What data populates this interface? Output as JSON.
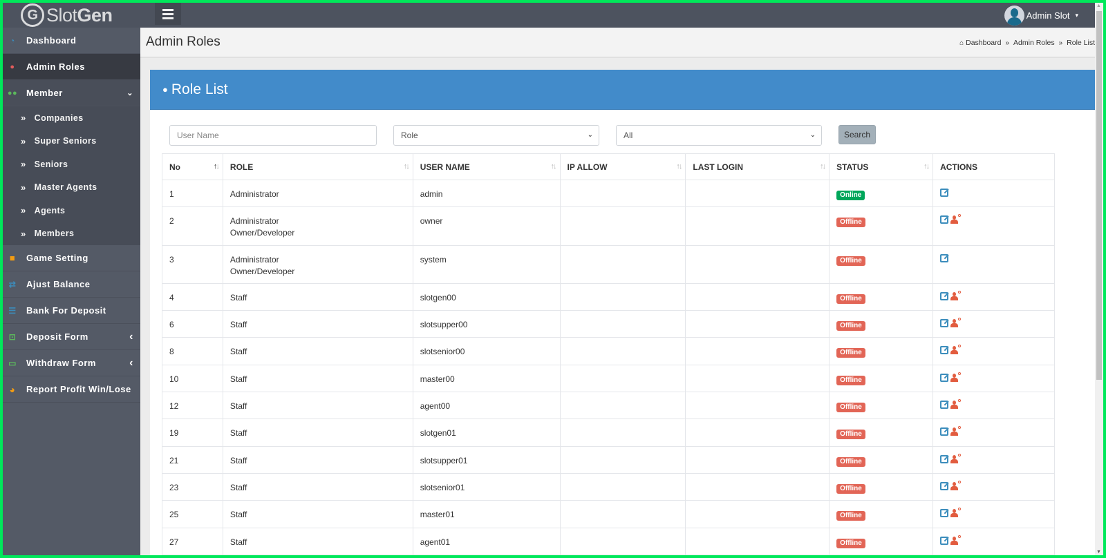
{
  "app": {
    "logo_light": "Slot",
    "logo_bold": "Gen",
    "logo_mark": "G"
  },
  "topbar": {
    "menu_toggle_icon": "hamburger-icon",
    "user_name": "Admin Slot",
    "user_caret": "▾"
  },
  "sidebar": {
    "items": [
      {
        "label": "Dashboard",
        "icon": "dashboard-gauge-icon",
        "glyph": "◔",
        "color": "#3c8dbc"
      },
      {
        "label": "Admin Roles",
        "icon": "user-icon",
        "glyph": "👤",
        "color": "#e25c5c"
      },
      {
        "label": "Member",
        "icon": "users-icon",
        "glyph": "👥",
        "color": "#5cb85c",
        "arrow": "⌄"
      },
      {
        "label": "Game Setting",
        "icon": "gamepad-icon",
        "glyph": "👾",
        "color": "#f39c12"
      },
      {
        "label": "Ajust Balance",
        "icon": "shuffle-icon",
        "glyph": "⇄",
        "color": "#3c8dbc"
      },
      {
        "label": "Bank For Deposit",
        "icon": "list-icon",
        "glyph": "☰",
        "color": "#3c8dbc"
      },
      {
        "label": "Deposit Form",
        "icon": "upload-laptop-icon",
        "glyph": "⊡",
        "color": "#5cb85c",
        "arrow": "‹"
      },
      {
        "label": "Withdraw Form",
        "icon": "laptop-icon",
        "glyph": "▭",
        "color": "#5cb85c",
        "arrow": "‹"
      },
      {
        "label": "Report Profit Win/Lose",
        "icon": "pie-chart-icon",
        "glyph": "◕",
        "color": "#f39c12"
      }
    ],
    "submenu_member": [
      {
        "label": "Companies"
      },
      {
        "label": "Super Seniors"
      },
      {
        "label": "Seniors"
      },
      {
        "label": "Master Agents"
      },
      {
        "label": "Agents"
      },
      {
        "label": "Members"
      }
    ],
    "submenu_glyph": "»"
  },
  "header": {
    "page_title": "Admin Roles",
    "breadcrumb": [
      "Dashboard",
      "Admin Roles",
      "Role List"
    ],
    "breadcrumb_sep": "»"
  },
  "box": {
    "title": "Role List"
  },
  "filters": {
    "username_placeholder": "User Name",
    "username_value": "",
    "role_selected": "Role",
    "status_selected": "All",
    "search_label": "Search"
  },
  "table": {
    "columns": [
      "No",
      "ROLE",
      "USER NAME",
      "IP ALLOW",
      "LAST LOGIN",
      "STATUS",
      "ACTIONS"
    ],
    "rows": [
      {
        "no": "1",
        "role": [
          "Administrator"
        ],
        "username": "admin",
        "ip_allow": "",
        "last_login": "",
        "status": "Online",
        "actions": [
          "edit"
        ]
      },
      {
        "no": "2",
        "role": [
          "Administrator",
          "Owner/Developer"
        ],
        "username": "owner",
        "ip_allow": "",
        "last_login": "",
        "status": "Offline",
        "actions": [
          "edit",
          "delete-user"
        ]
      },
      {
        "no": "3",
        "role": [
          "Administrator",
          "Owner/Developer"
        ],
        "username": "system",
        "ip_allow": "",
        "last_login": "",
        "status": "Offline",
        "actions": [
          "edit"
        ]
      },
      {
        "no": "4",
        "role": [
          "Staff"
        ],
        "username": "slotgen00",
        "ip_allow": "",
        "last_login": "",
        "status": "Offline",
        "actions": [
          "edit",
          "delete-user"
        ]
      },
      {
        "no": "6",
        "role": [
          "Staff"
        ],
        "username": "slotsupper00",
        "ip_allow": "",
        "last_login": "",
        "status": "Offline",
        "actions": [
          "edit",
          "delete-user"
        ]
      },
      {
        "no": "8",
        "role": [
          "Staff"
        ],
        "username": "slotsenior00",
        "ip_allow": "",
        "last_login": "",
        "status": "Offline",
        "actions": [
          "edit",
          "delete-user"
        ]
      },
      {
        "no": "10",
        "role": [
          "Staff"
        ],
        "username": "master00",
        "ip_allow": "",
        "last_login": "",
        "status": "Offline",
        "actions": [
          "edit",
          "delete-user"
        ]
      },
      {
        "no": "12",
        "role": [
          "Staff"
        ],
        "username": "agent00",
        "ip_allow": "",
        "last_login": "",
        "status": "Offline",
        "actions": [
          "edit",
          "delete-user"
        ]
      },
      {
        "no": "19",
        "role": [
          "Staff"
        ],
        "username": "slotgen01",
        "ip_allow": "",
        "last_login": "",
        "status": "Offline",
        "actions": [
          "edit",
          "delete-user"
        ]
      },
      {
        "no": "21",
        "role": [
          "Staff"
        ],
        "username": "slotsupper01",
        "ip_allow": "",
        "last_login": "",
        "status": "Offline",
        "actions": [
          "edit",
          "delete-user"
        ]
      },
      {
        "no": "23",
        "role": [
          "Staff"
        ],
        "username": "slotsenior01",
        "ip_allow": "",
        "last_login": "",
        "status": "Offline",
        "actions": [
          "edit",
          "delete-user"
        ]
      },
      {
        "no": "25",
        "role": [
          "Staff"
        ],
        "username": "master01",
        "ip_allow": "",
        "last_login": "",
        "status": "Offline",
        "actions": [
          "edit",
          "delete-user"
        ]
      },
      {
        "no": "27",
        "role": [
          "Staff"
        ],
        "username": "agent01",
        "ip_allow": "",
        "last_login": "",
        "status": "Offline",
        "actions": [
          "edit",
          "delete-user"
        ]
      }
    ]
  },
  "colors": {
    "topbar": "#4d535f",
    "sidebar": "#545a66",
    "sidebar_active": "#373a42",
    "box_header": "#428bca",
    "online": "#00a65a",
    "offline": "#dd4b39",
    "edit_icon": "#3c8dbc",
    "delete_icon": "#e25c3f"
  }
}
